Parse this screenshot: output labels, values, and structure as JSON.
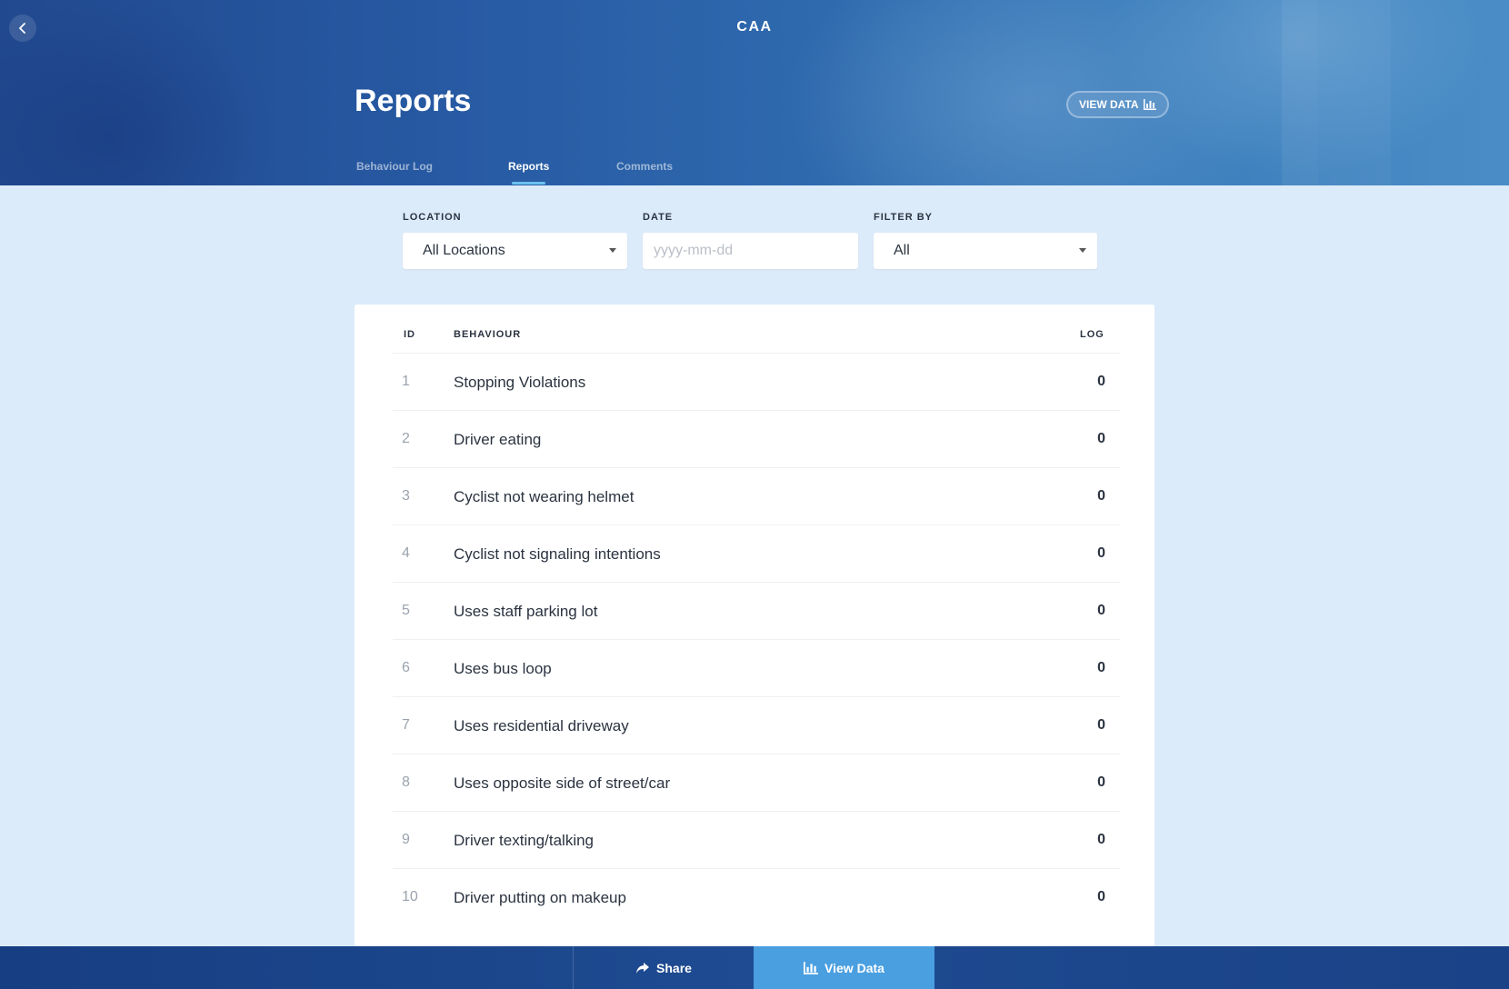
{
  "header": {
    "brand": "CAA",
    "title": "Reports",
    "view_data_label": "VIEW DATA"
  },
  "tabs": [
    {
      "label": "Behaviour Log",
      "active": false
    },
    {
      "label": "Reports",
      "active": true
    },
    {
      "label": "Comments",
      "active": false
    }
  ],
  "filters": {
    "location": {
      "label": "LOCATION",
      "value": "All Locations"
    },
    "date": {
      "label": "DATE",
      "placeholder": "yyyy-mm-dd",
      "value": ""
    },
    "filter_by": {
      "label": "FILTER BY",
      "value": "All"
    }
  },
  "table": {
    "columns": {
      "id": "ID",
      "behaviour": "BEHAVIOUR",
      "log": "LOG"
    },
    "rows": [
      {
        "id": "1",
        "behaviour": "Stopping Violations",
        "log": "0"
      },
      {
        "id": "2",
        "behaviour": "Driver eating",
        "log": "0"
      },
      {
        "id": "3",
        "behaviour": "Cyclist not wearing helmet",
        "log": "0"
      },
      {
        "id": "4",
        "behaviour": "Cyclist not signaling intentions",
        "log": "0"
      },
      {
        "id": "5",
        "behaviour": "Uses staff parking lot",
        "log": "0"
      },
      {
        "id": "6",
        "behaviour": "Uses bus loop",
        "log": "0"
      },
      {
        "id": "7",
        "behaviour": "Uses residential driveway",
        "log": "0"
      },
      {
        "id": "8",
        "behaviour": "Uses opposite side of street/car",
        "log": "0"
      },
      {
        "id": "9",
        "behaviour": "Driver texting/talking",
        "log": "0"
      },
      {
        "id": "10",
        "behaviour": "Driver putting on makeup",
        "log": "0"
      }
    ]
  },
  "bottom_bar": {
    "share_label": "Share",
    "view_data_label": "View Data"
  },
  "colors": {
    "header_start": "#21498f",
    "header_end": "#4a8dc6",
    "page_background": "#dcebfa",
    "tab_indicator": "#6bc1f0",
    "primary_button": "#4a9fe0",
    "bottom_bar": "#1e4b92"
  },
  "icons": {
    "back": "chevron-left-icon",
    "view_data": "bar-chart-icon",
    "share": "share-arrow-icon",
    "dropdown": "caret-down-icon"
  }
}
